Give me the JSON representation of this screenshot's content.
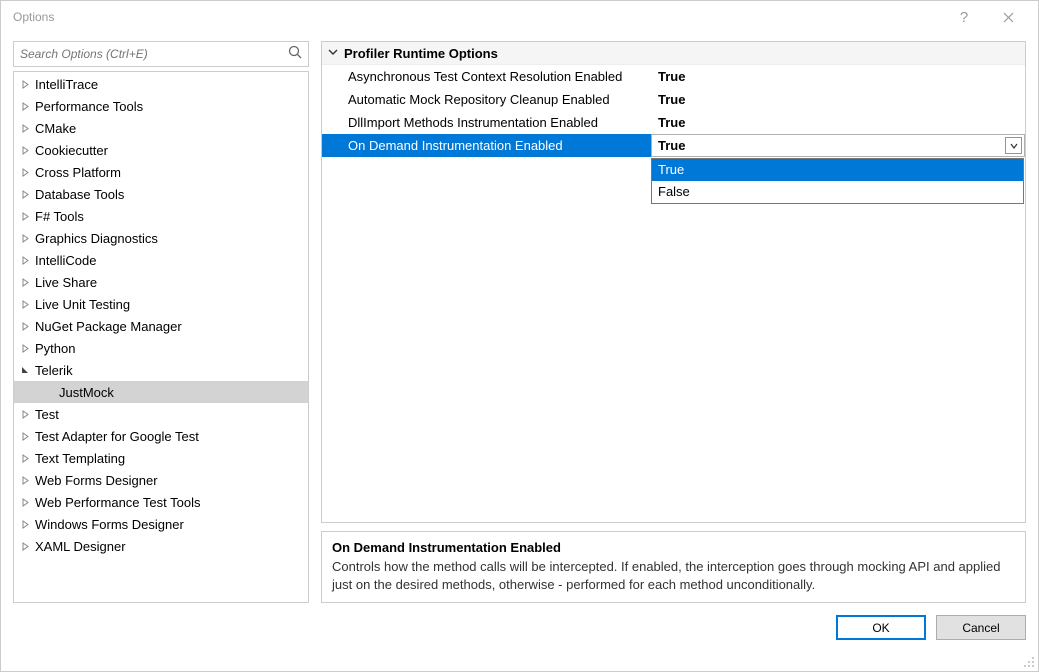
{
  "window": {
    "title": "Options"
  },
  "search": {
    "placeholder": "Search Options (Ctrl+E)"
  },
  "tree": {
    "items": [
      {
        "label": "IntelliTrace",
        "expanded": false,
        "depth": 0
      },
      {
        "label": "Performance Tools",
        "expanded": false,
        "depth": 0
      },
      {
        "label": "CMake",
        "expanded": false,
        "depth": 0
      },
      {
        "label": "Cookiecutter",
        "expanded": false,
        "depth": 0
      },
      {
        "label": "Cross Platform",
        "expanded": false,
        "depth": 0
      },
      {
        "label": "Database Tools",
        "expanded": false,
        "depth": 0
      },
      {
        "label": "F# Tools",
        "expanded": false,
        "depth": 0
      },
      {
        "label": "Graphics Diagnostics",
        "expanded": false,
        "depth": 0
      },
      {
        "label": "IntelliCode",
        "expanded": false,
        "depth": 0
      },
      {
        "label": "Live Share",
        "expanded": false,
        "depth": 0
      },
      {
        "label": "Live Unit Testing",
        "expanded": false,
        "depth": 0
      },
      {
        "label": "NuGet Package Manager",
        "expanded": false,
        "depth": 0
      },
      {
        "label": "Python",
        "expanded": false,
        "depth": 0
      },
      {
        "label": "Telerik",
        "expanded": true,
        "depth": 0
      },
      {
        "label": "JustMock",
        "expanded": false,
        "depth": 1,
        "selected": true
      },
      {
        "label": "Test",
        "expanded": false,
        "depth": 0
      },
      {
        "label": "Test Adapter for Google Test",
        "expanded": false,
        "depth": 0
      },
      {
        "label": "Text Templating",
        "expanded": false,
        "depth": 0
      },
      {
        "label": "Web Forms Designer",
        "expanded": false,
        "depth": 0
      },
      {
        "label": "Web Performance Test Tools",
        "expanded": false,
        "depth": 0
      },
      {
        "label": "Windows Forms Designer",
        "expanded": false,
        "depth": 0
      },
      {
        "label": "XAML Designer",
        "expanded": false,
        "depth": 0
      }
    ]
  },
  "propertyGrid": {
    "category": "Profiler Runtime Options",
    "rows": [
      {
        "name": "Asynchronous Test Context Resolution Enabled",
        "value": "True"
      },
      {
        "name": "Automatic Mock Repository Cleanup Enabled",
        "value": "True"
      },
      {
        "name": "DllImport Methods Instrumentation Enabled",
        "value": "True"
      },
      {
        "name": "On Demand Instrumentation Enabled",
        "value": "True",
        "selected": true
      }
    ],
    "dropdown": {
      "options": [
        "True",
        "False"
      ],
      "selected": "True"
    }
  },
  "description": {
    "title": "On Demand Instrumentation Enabled",
    "text": "Controls how the method calls will be intercepted. If enabled, the interception goes through mocking API and applied just on the desired methods, otherwise - performed for each method unconditionally."
  },
  "buttons": {
    "ok": "OK",
    "cancel": "Cancel"
  }
}
